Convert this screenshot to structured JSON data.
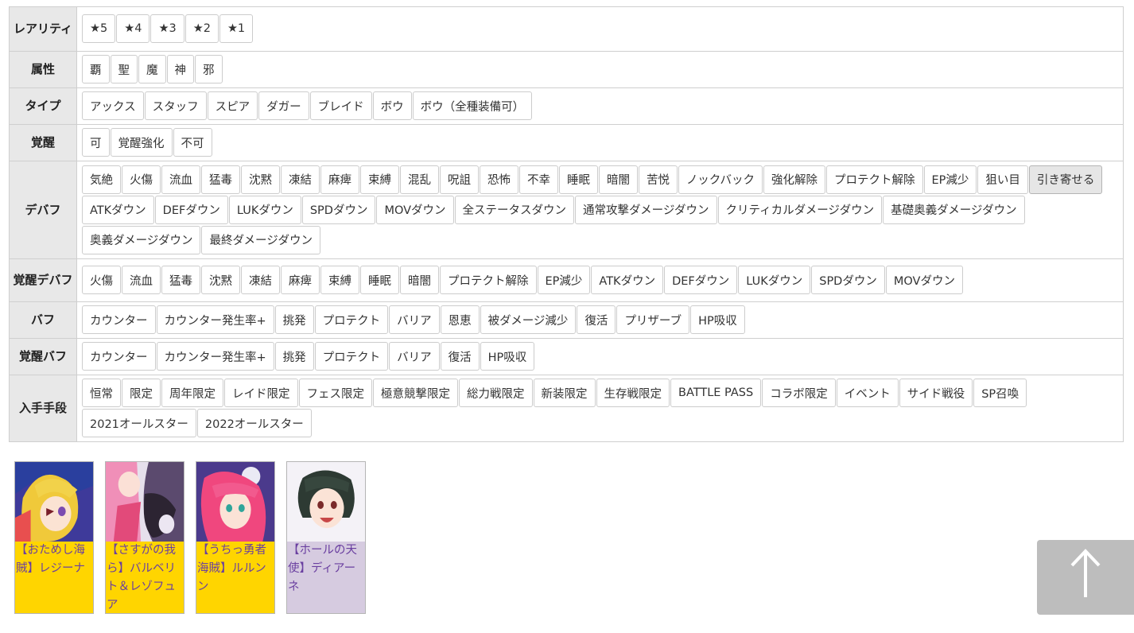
{
  "filters": {
    "rarity": {
      "label": "レアリティ",
      "options": [
        "★5",
        "★4",
        "★3",
        "★2",
        "★1"
      ]
    },
    "attribute": {
      "label": "属性",
      "options": [
        "覇",
        "聖",
        "魔",
        "神",
        "邪"
      ]
    },
    "type": {
      "label": "タイプ",
      "options": [
        "アックス",
        "スタッフ",
        "スピア",
        "ダガー",
        "ブレイド",
        "ボウ",
        "ボウ（全種装備可）"
      ]
    },
    "awakening": {
      "label": "覚醒",
      "options": [
        "可",
        "覚醒強化",
        "不可"
      ]
    },
    "debuff": {
      "label": "デバフ",
      "active": "引き寄せる",
      "options": [
        "気絶",
        "火傷",
        "流血",
        "猛毒",
        "沈黙",
        "凍結",
        "麻痺",
        "束縛",
        "混乱",
        "呪詛",
        "恐怖",
        "不幸",
        "睡眠",
        "暗闇",
        "苦悦",
        "ノックバック",
        "強化解除",
        "プロテクト解除",
        "EP減少",
        "狙い目",
        "引き寄せる",
        "ATKダウン",
        "DEFダウン",
        "LUKダウン",
        "SPDダウン",
        "MOVダウン",
        "全ステータスダウン",
        "通常攻撃ダメージダウン",
        "クリティカルダメージダウン",
        "基礎奥義ダメージダウン",
        "奥義ダメージダウン",
        "最終ダメージダウン"
      ]
    },
    "awakening_debuff": {
      "label": "覚醒デバフ",
      "options": [
        "火傷",
        "流血",
        "猛毒",
        "沈黙",
        "凍結",
        "麻痺",
        "束縛",
        "睡眠",
        "暗闇",
        "プロテクト解除",
        "EP減少",
        "ATKダウン",
        "DEFダウン",
        "LUKダウン",
        "SPDダウン",
        "MOVダウン"
      ]
    },
    "buff": {
      "label": "バフ",
      "options": [
        "カウンター",
        "カウンター発生率+",
        "挑発",
        "プロテクト",
        "バリア",
        "恩恵",
        "被ダメージ減少",
        "復活",
        "プリザーブ",
        "HP吸収"
      ]
    },
    "awakening_buff": {
      "label": "覚醒バフ",
      "options": [
        "カウンター",
        "カウンター発生率+",
        "挑発",
        "プロテクト",
        "バリア",
        "復活",
        "HP吸収"
      ]
    },
    "acquisition": {
      "label": "入手手段",
      "options": [
        "恒常",
        "限定",
        "周年限定",
        "レイド限定",
        "フェス限定",
        "極意競撃限定",
        "総力戦限定",
        "新装限定",
        "生存戦限定",
        "BATTLE PASS",
        "コラボ限定",
        "イベント",
        "サイド戦役",
        "SP召喚",
        "2021オールスター",
        "2022オールスター"
      ]
    }
  },
  "results": [
    {
      "name": "【おためし海賊】レジーナ",
      "bg": "#ffd500"
    },
    {
      "name": "【さすがの我ら】バルベリト＆レゾフュア",
      "bg": "#ffd500"
    },
    {
      "name": "【うちっ勇者海賊】ルルンン",
      "bg": "#ffd500"
    },
    {
      "name": "【ホールの天使】ディアーネ",
      "bg": "#d6cbe0"
    }
  ],
  "colors": {
    "header_bg": "#e8e8e8",
    "link": "#6a3fa0",
    "scroll_top_bg": "#bdbdbd"
  },
  "icons": {
    "scroll_top": "arrow-up-icon"
  }
}
